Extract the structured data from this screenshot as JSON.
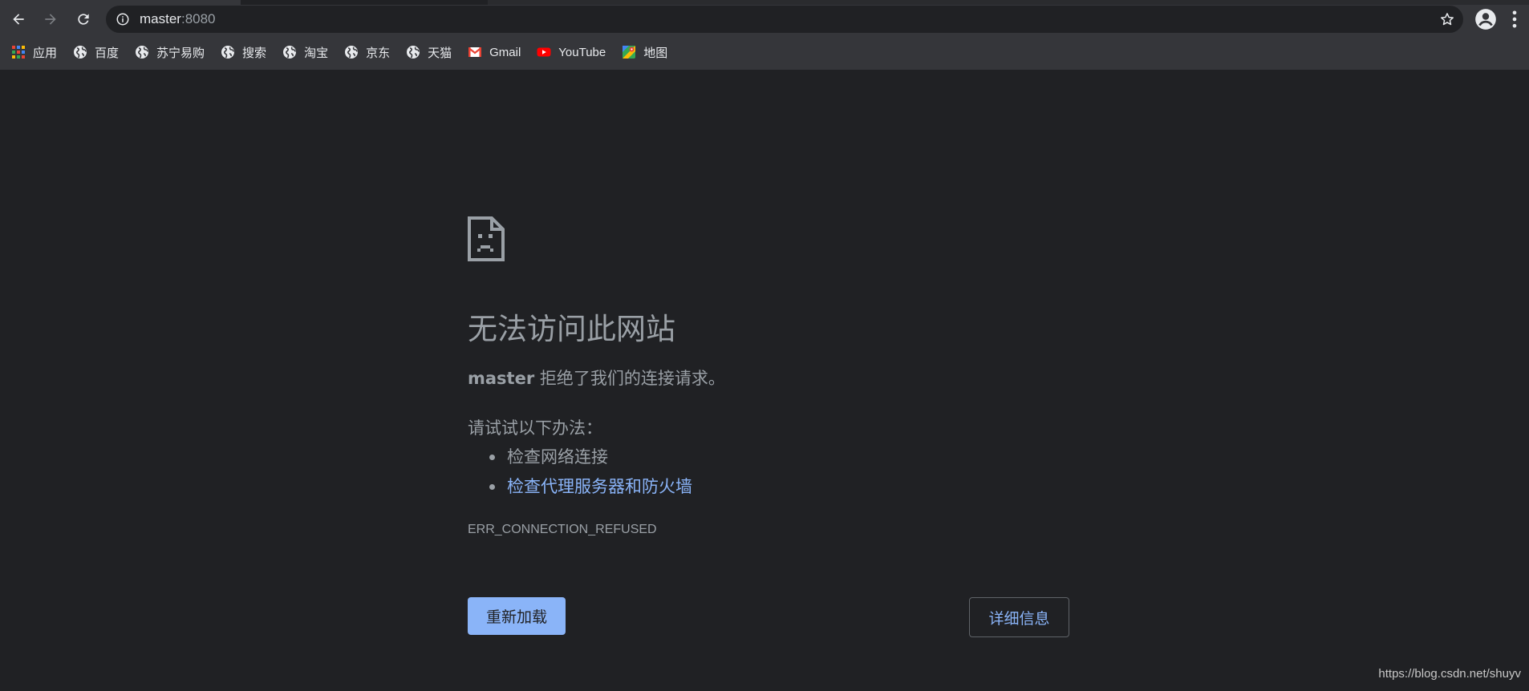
{
  "address_bar": {
    "host": "master",
    "port": ":8080"
  },
  "bookmarks": [
    {
      "label": "应用",
      "icon": "apps-grid-icon"
    },
    {
      "label": "百度",
      "icon": "globe-icon"
    },
    {
      "label": "苏宁易购",
      "icon": "globe-icon"
    },
    {
      "label": "搜索",
      "icon": "globe-icon"
    },
    {
      "label": "淘宝",
      "icon": "globe-icon"
    },
    {
      "label": "京东",
      "icon": "globe-icon"
    },
    {
      "label": "天猫",
      "icon": "globe-icon"
    },
    {
      "label": "Gmail",
      "icon": "gmail-icon"
    },
    {
      "label": "YouTube",
      "icon": "youtube-icon"
    },
    {
      "label": "地图",
      "icon": "maps-icon"
    }
  ],
  "error_page": {
    "title": "无法访问此网站",
    "host": "master",
    "message": " 拒绝了我们的连接请求。",
    "try_label": "请试试以下办法：",
    "suggestions": [
      "检查网络连接",
      "检查代理服务器和防火墙"
    ],
    "error_code": "ERR_CONNECTION_REFUSED",
    "reload_label": "重新加载",
    "details_label": "详细信息"
  },
  "watermark": "https://blog.csdn.net/shuyv",
  "colors": {
    "background": "#202124",
    "toolbar": "#35363a",
    "text": "#9aa0a6",
    "link": "#8ab4f8"
  }
}
